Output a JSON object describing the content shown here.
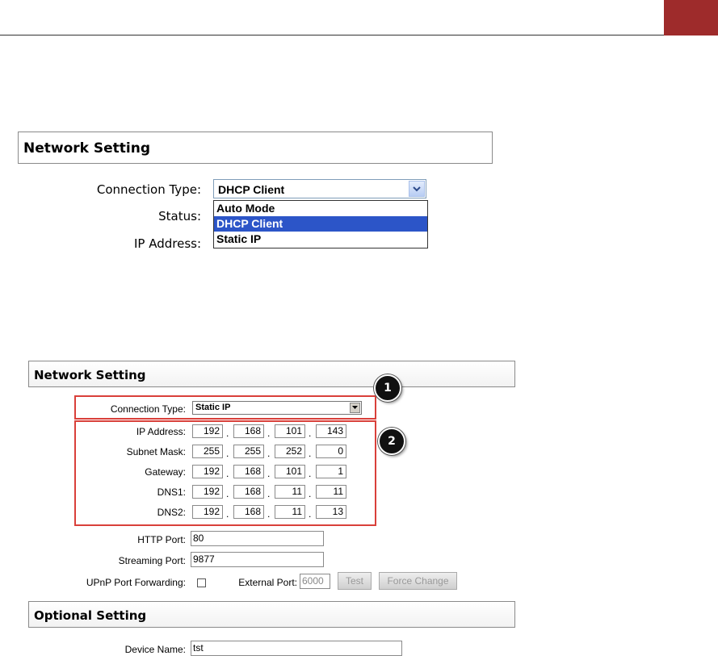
{
  "screen1": {
    "title": "Network Setting",
    "connection_type_label": "Connection Type:",
    "status_label": "Status:",
    "ip_address_label": "IP Address:",
    "selected": "DHCP Client",
    "options": [
      "Auto Mode",
      "DHCP Client",
      "Static IP"
    ]
  },
  "screen2": {
    "title": "Network Setting",
    "optional_title": "Optional Setting",
    "connection_type_label": "Connection Type:",
    "connection_type_value": "Static IP",
    "callouts": [
      "1",
      "2"
    ],
    "ip_rows": [
      {
        "label": "IP Address:",
        "octets": [
          "192",
          "168",
          "101",
          "143"
        ]
      },
      {
        "label": "Subnet Mask:",
        "octets": [
          "255",
          "255",
          "252",
          "0"
        ]
      },
      {
        "label": "Gateway:",
        "octets": [
          "192",
          "168",
          "101",
          "1"
        ]
      },
      {
        "label": "DNS1:",
        "octets": [
          "192",
          "168",
          "11",
          "11"
        ]
      },
      {
        "label": "DNS2:",
        "octets": [
          "192",
          "168",
          "11",
          "13"
        ]
      }
    ],
    "http_port_label": "HTTP Port:",
    "http_port_value": "80",
    "streaming_port_label": "Streaming Port:",
    "streaming_port_value": "9877",
    "upnp_label": "UPnP Port Forwarding:",
    "external_port_label": "External Port:",
    "external_port_value": "6000",
    "test_button": "Test",
    "force_change_button": "Force Change",
    "device_name_label": "Device Name:",
    "device_name_value": "tst"
  },
  "colors": {
    "accent": "#9e2b2b",
    "highlight": "#d9403a",
    "selection": "#2c55c8"
  }
}
